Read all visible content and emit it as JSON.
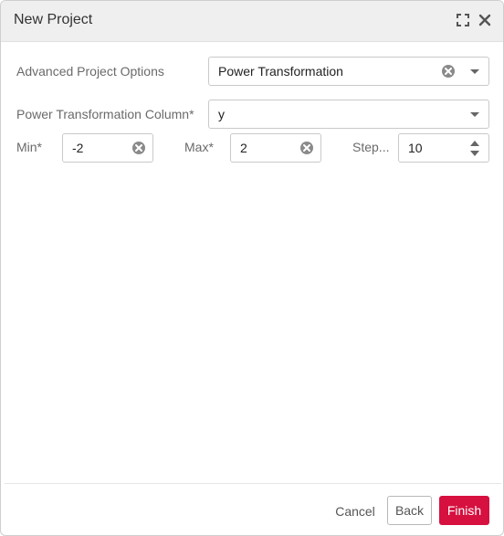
{
  "dialog": {
    "title": "New Project"
  },
  "form": {
    "advanced_options": {
      "label": "Advanced Project Options",
      "value": "Power Transformation"
    },
    "column": {
      "label": "Power Transformation Column*",
      "value": "y"
    },
    "min": {
      "label": "Min*",
      "value": "-2"
    },
    "max": {
      "label": "Max*",
      "value": "2"
    },
    "step": {
      "label": "Step...",
      "value": "10"
    }
  },
  "footer": {
    "cancel_label": "Cancel",
    "back_label": "Back",
    "finish_label": "Finish"
  },
  "colors": {
    "accent": "#d6103f",
    "titlebar": "#efefef",
    "border": "#c9c9c9"
  },
  "icons": [
    "expand-icon",
    "close-icon",
    "clear-icon",
    "chevron-down-icon",
    "spinner-up-icon",
    "spinner-down-icon"
  ]
}
